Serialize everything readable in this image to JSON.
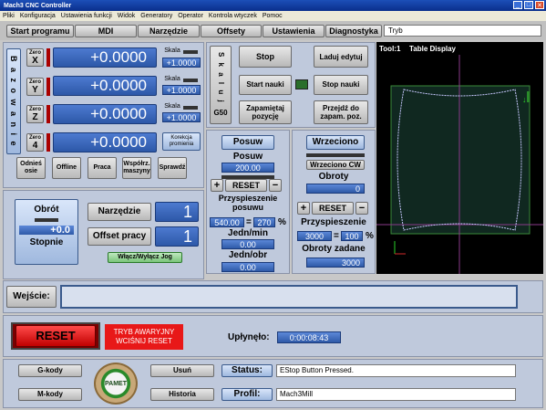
{
  "title": "Mach3 CNC Controller",
  "menu": [
    "Pliki",
    "Konfiguracja",
    "Ustawienia funkcji",
    "Widok",
    "Generatory",
    "Operator",
    "Kontrola wtyczek",
    "Pomoc"
  ],
  "tabs": [
    "Start programu",
    "MDI",
    "Narzędzie",
    "Offsety",
    "Ustawienia",
    "Diagnostyka"
  ],
  "mode_field": "Tryb",
  "axes": [
    {
      "zero": "Zero",
      "letter": "X",
      "value": "+0.0000",
      "scale_label": "Skala",
      "scale": "+1.0000"
    },
    {
      "zero": "Zero",
      "letter": "Y",
      "value": "+0.0000",
      "scale_label": "Skala",
      "scale": "+1.0000"
    },
    {
      "zero": "Zero",
      "letter": "Z",
      "value": "+0.0000",
      "scale_label": "Skala",
      "scale": "+1.0000"
    },
    {
      "zero": "Zero",
      "letter": "4",
      "value": "+0.0000",
      "scale_label": "Korekcja promienia",
      "scale": ""
    }
  ],
  "bazowanie": "B a z o w a n i e",
  "skaluj": "S k a l u j",
  "g50": "G50",
  "axis_buttons": [
    "Odnieś osie",
    "Offline",
    "Praca",
    "Współrz. maszyny",
    "Sprawdź"
  ],
  "center_buttons": {
    "stop": "Stop",
    "learn_start": "Start nauki",
    "save_pos": "Zapamiętaj pozycję",
    "load_edit": "Laduj edytuj",
    "learn_stop": "Stop nauki",
    "goto_pos": "Przejdź do zapam. poz."
  },
  "toolpath": {
    "tool": "Tool:1",
    "table": "Table Display"
  },
  "spindle_speed": {
    "title": "Obrót",
    "value": "+0.0",
    "unit": "Stopnie"
  },
  "tool": {
    "label": "Narzędzie",
    "value": "1"
  },
  "work_offset": {
    "label": "Offset pracy",
    "value": "1"
  },
  "jog_button": "Włącz/Wyłącz Jog",
  "feed": {
    "button": "Posuw",
    "label": "Posuw",
    "value": "200.00",
    "reset": "RESET",
    "accel_label": "Przyspieszenie posuwu",
    "accel_left": "540.00",
    "eq": "=",
    "accel_pct": "270",
    "pct": "%",
    "units_min_label": "Jedn/min",
    "units_min": "0.00",
    "units_rev_label": "Jedn/obr",
    "units_rev": "0.00",
    "plus": "+",
    "minus": "−"
  },
  "spindle": {
    "button": "Wrzeciono",
    "cw": "Wrzeciono CW",
    "rpm_label": "Obroty",
    "rpm": "0",
    "reset": "RESET",
    "accel_label": "Przyspieszenie",
    "accel_left": "3000",
    "eq": "=",
    "accel_pct": "100",
    "pct": "%",
    "set_label": "Obroty zadane",
    "set": "3000",
    "plus": "+",
    "minus": "−"
  },
  "input_label": "Wejście:",
  "reset_button": "RESET",
  "estop_text": "TRYB AWARYJNY WCIŚNIJ RESET",
  "elapsed_label": "Upłynęło:",
  "elapsed": "0:00:08:43",
  "bottom_buttons": {
    "gcode": "G-kody",
    "usun": "Usuń",
    "mcode": "M-kody",
    "historia": "Historia"
  },
  "logo_text": "PAMET",
  "status_label": "Status:",
  "status": "EStop Button Pressed.",
  "profile_label": "Profil:",
  "profile": "Mach3Mill"
}
